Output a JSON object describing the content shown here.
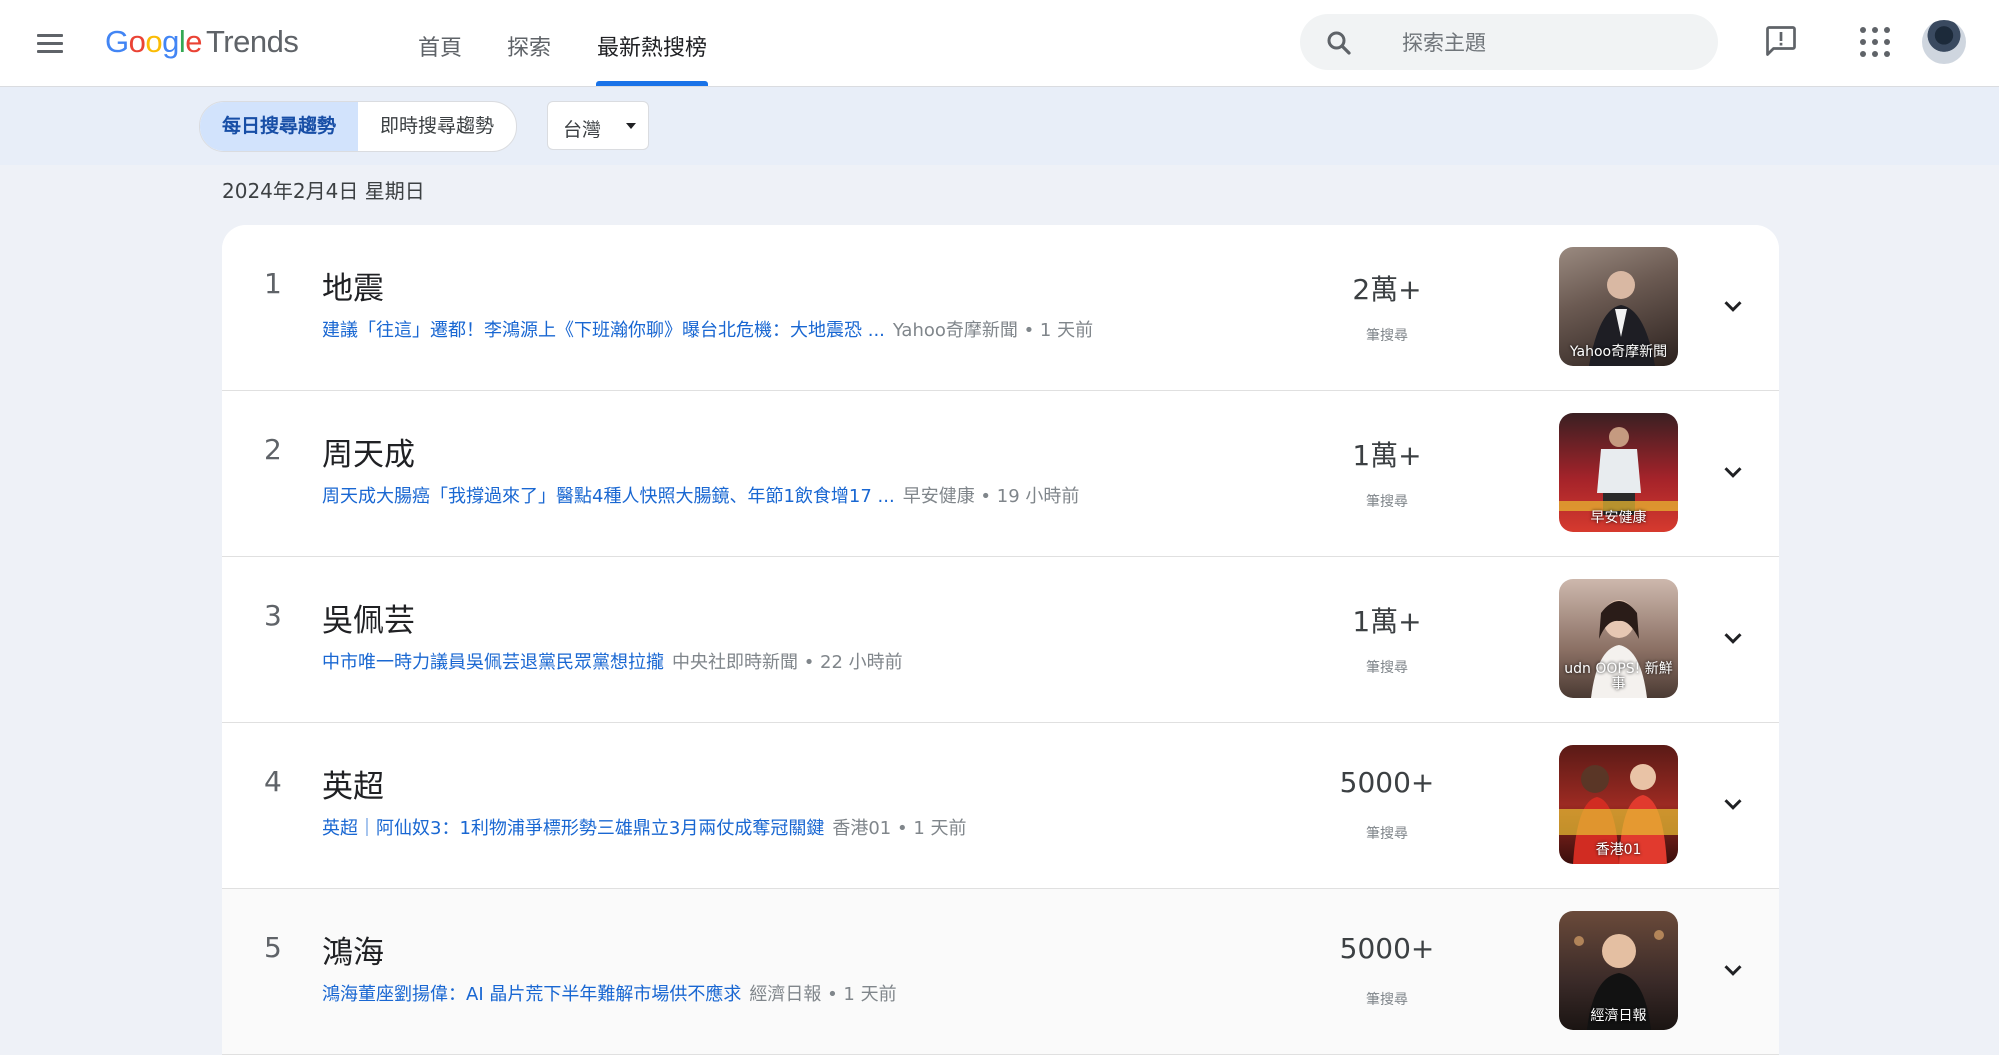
{
  "header": {
    "logo_google": [
      "G",
      "o",
      "o",
      "g",
      "l",
      "e"
    ],
    "logo_trends": "Trends",
    "nav": [
      {
        "label": "首頁"
      },
      {
        "label": "探索"
      },
      {
        "label": "最新熱搜榜"
      }
    ],
    "search_placeholder": "探索主題"
  },
  "filters": {
    "tabs": [
      {
        "label": "每日搜尋趨勢"
      },
      {
        "label": "即時搜尋趨勢"
      }
    ],
    "region": "台灣"
  },
  "date": "2024年2月4日 星期日",
  "trends": [
    {
      "rank": "1",
      "title": "地震",
      "article": "建議「往這」遷都！李鴻源上《下班瀚你聊》曝台北危機：大地震恐 ...",
      "meta": "Yahoo奇摩新聞 • 1 天前",
      "count": "2萬+",
      "count_label": "筆搜尋",
      "thumb_caption": "Yahoo奇摩新聞",
      "thumb_color": "#6b5a52"
    },
    {
      "rank": "2",
      "title": "周天成",
      "article": "周天成大腸癌「我撐過來了」醫點4種人快照大腸鏡、年節1飲食增17 ...",
      "meta": "早安健康 • 19 小時前",
      "count": "1萬+",
      "count_label": "筆搜尋",
      "thumb_caption": "早安健康",
      "thumb_color": "#a4232a"
    },
    {
      "rank": "3",
      "title": "吳佩芸",
      "article": "中市唯一時力議員吳佩芸退黨民眾黨想拉攏",
      "meta": "中央社即時新聞 • 22 小時前",
      "count": "1萬+",
      "count_label": "筆搜尋",
      "thumb_caption": "udn OOPS! 新鮮事",
      "thumb_color": "#8a6f63"
    },
    {
      "rank": "4",
      "title": "英超",
      "article": "英超｜阿仙奴3：1利物浦爭標形勢三雄鼎立3月兩仗成奪冠關鍵",
      "meta": "香港01 • 1 天前",
      "count": "5000+",
      "count_label": "筆搜尋",
      "thumb_caption": "香港01",
      "thumb_color": "#9c2a22"
    },
    {
      "rank": "5",
      "title": "鴻海",
      "article": "鴻海董座劉揚偉：AI 晶片荒下半年難解市場供不應求",
      "meta": "經濟日報 • 1 天前",
      "count": "5000+",
      "count_label": "筆搜尋",
      "thumb_caption": "經濟日報",
      "thumb_color": "#3a2a28"
    }
  ]
}
